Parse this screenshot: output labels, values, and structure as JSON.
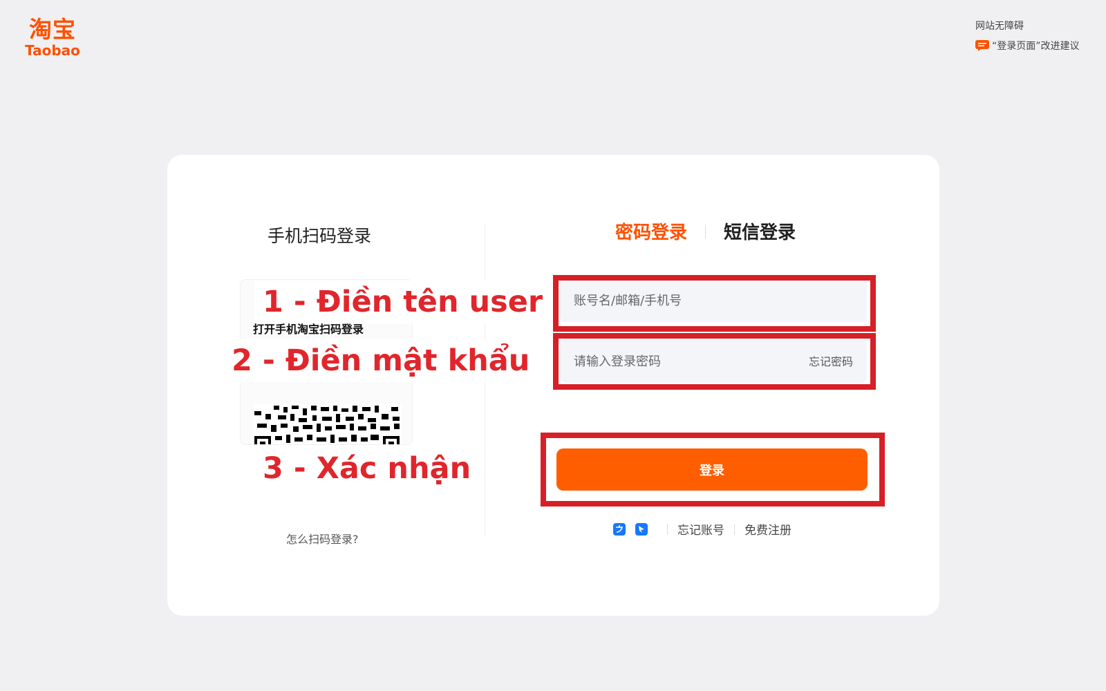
{
  "brand": {
    "logo_cn": "淘宝",
    "logo_en": "Taobao",
    "color": "#ff5000"
  },
  "top_right": {
    "accessibility": "网站无障碍",
    "feedback": "“登录页面”改进建议",
    "feedback_icon": "chat-bubble-icon"
  },
  "qr_panel": {
    "title": "手机扫码登录",
    "caption": "打开手机淘宝扫码登录",
    "help": "怎么扫码登录?"
  },
  "login_panel": {
    "tabs": [
      {
        "label": "密码登录",
        "active": true
      },
      {
        "label": "短信登录",
        "active": false
      }
    ],
    "username_placeholder": "账号名/邮箱/手机号",
    "password_placeholder": "请输入登录密码",
    "forgot_password": "忘记密码",
    "login_button": "登录",
    "bottom_icons": [
      "alipay-icon",
      "dingtalk-icon"
    ],
    "forgot_account": "忘记账号",
    "register": "免费注册"
  },
  "annotations": {
    "step1": "1 - Điền tên user",
    "step2": "2 - Điền mật khẩu",
    "step3": "3 - Xác nhận",
    "color": "#d61f26"
  }
}
